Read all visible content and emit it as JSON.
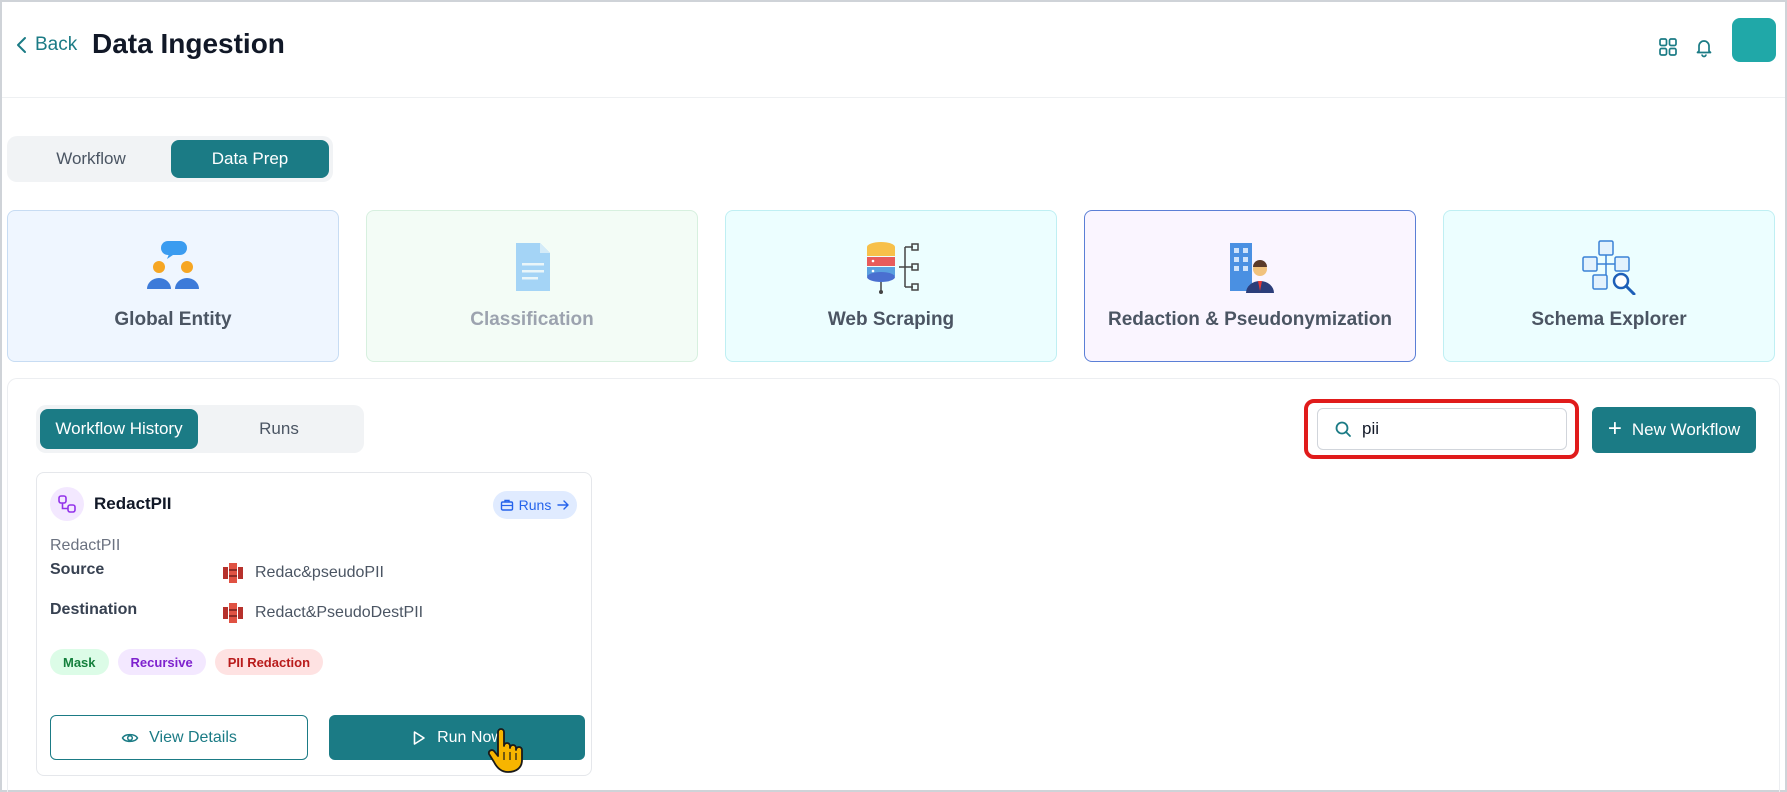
{
  "header": {
    "back_label": "Back",
    "title": "Data Ingestion",
    "icons": [
      "grid-icon",
      "bell-icon"
    ],
    "avatar_color": "#20a8a8"
  },
  "top_tabs": {
    "workflow": "Workflow",
    "data_prep": "Data Prep",
    "active": "Data Prep"
  },
  "cards": [
    {
      "label": "Global Entity",
      "icon": "people-chat-icon"
    },
    {
      "label": "Classification",
      "icon": "document-icon",
      "state": "disabled"
    },
    {
      "label": "Web Scraping",
      "icon": "database-network-icon"
    },
    {
      "label": "Redaction & Pseudonymization",
      "icon": "building-person-icon",
      "state": "selected"
    },
    {
      "label": "Schema Explorer",
      "icon": "schema-search-icon"
    }
  ],
  "sub_tabs": {
    "history": "Workflow History",
    "runs": "Runs",
    "active": "Workflow History"
  },
  "search": {
    "value": "pii",
    "highlight_color": "#e01b1b"
  },
  "new_workflow_label": "New Workflow",
  "workflow": {
    "title": "RedactPII",
    "runs_label": "Runs",
    "description": "RedactPII",
    "source_label": "Source",
    "source_value": "Redac&pseudoPII",
    "destination_label": "Destination",
    "destination_value": "Redact&PseudoDestPII",
    "tags": [
      "Mask",
      "Recursive",
      "PII Redaction"
    ],
    "view_details_label": "View Details",
    "run_now_label": "Run Now"
  },
  "colors": {
    "primary": "#1b7b85",
    "selected_card_border": "#5b7fd6"
  }
}
